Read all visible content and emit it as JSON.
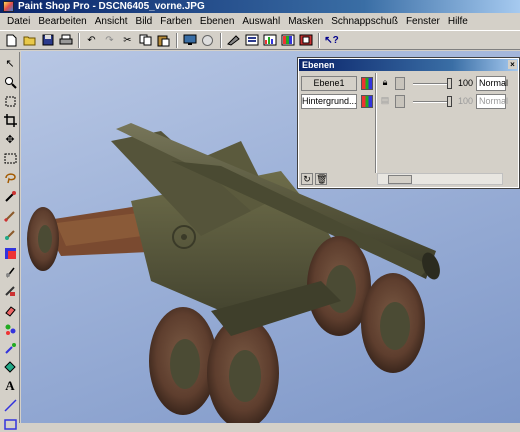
{
  "window": {
    "title": "Paint Shop Pro - DSCN6405_vorne.JPG"
  },
  "menu": {
    "items": [
      "Datei",
      "Bearbeiten",
      "Ansicht",
      "Bild",
      "Farben",
      "Ebenen",
      "Auswahl",
      "Masken",
      "Schnappschuß",
      "Fenster",
      "Hilfe"
    ]
  },
  "toolbar": {
    "icons": [
      "new-icon",
      "open-icon",
      "save-icon",
      "print-icon",
      "undo-icon",
      "redo-icon",
      "cut-icon",
      "copy-icon",
      "paste-icon",
      "screen-icon",
      "browse-icon",
      "tool-options-icon",
      "color-palette-icon",
      "histogram-icon",
      "layers-icon",
      "overview-icon",
      "help-icon"
    ]
  },
  "tools": {
    "icons": [
      "arrow-icon",
      "zoom-icon",
      "deform-icon",
      "crop-icon",
      "move-icon",
      "selection-icon",
      "freehand-icon",
      "eyedropper-icon",
      "paintbrush-icon",
      "clone-icon",
      "color-replacer-icon",
      "retouch-icon",
      "scratch-remover-icon",
      "eraser-icon",
      "picture-tube-icon",
      "airbrush-icon",
      "flood-fill-icon",
      "text-icon",
      "line-icon",
      "shape-icon"
    ]
  },
  "layers_palette": {
    "title": "Ebenen",
    "layers": [
      {
        "name": "Ebene1",
        "opacity": "100",
        "blend": "Normal"
      },
      {
        "name": "Hintergrund...",
        "opacity": "100",
        "blend": "Normal"
      }
    ]
  },
  "colors": {
    "titlebar": "#0a246a",
    "canvas_bg": "#9fb3d9",
    "gun_olive": "#5d5c3c",
    "tire_brown": "#6d4a38"
  }
}
